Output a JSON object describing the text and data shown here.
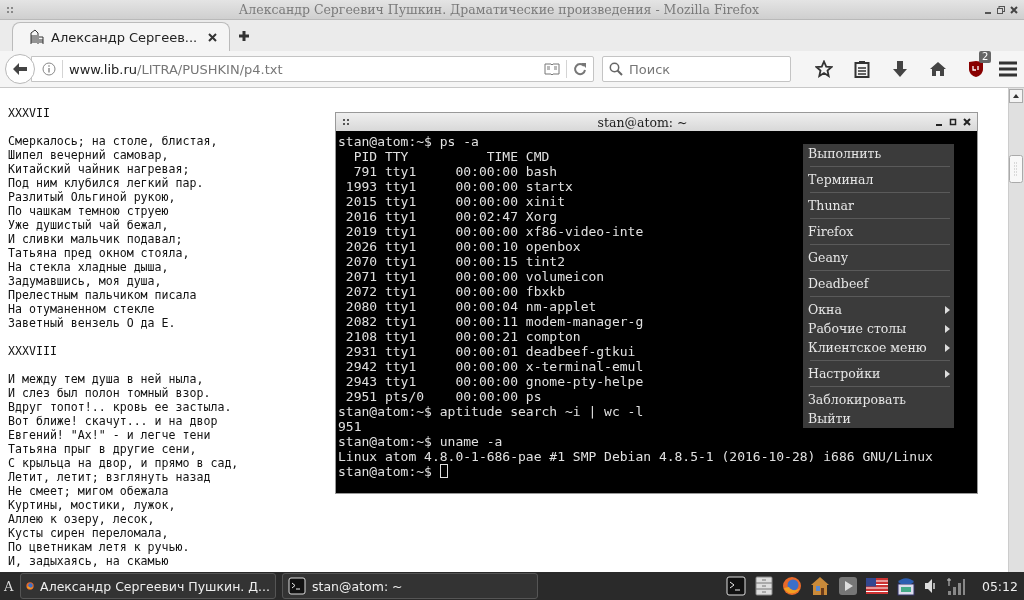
{
  "browser": {
    "title": "Александр Сергеевич Пушкин. Драматические произведения - Mozilla Firefox",
    "tabs": [
      {
        "label": "Александр Сергеев...",
        "selected": true
      }
    ],
    "url": {
      "host": "www.lib.ru",
      "path": "/LITRA/PUSHKIN/p4.txt"
    },
    "search": {
      "placeholder": "Поиск"
    },
    "addon_badge": "2",
    "page": [
      {
        "kind": "heading",
        "text": "XXXVII"
      },
      {
        "kind": "verse",
        "lines": [
          "Смеркалось; на столе, блистая,",
          "Шипел вечерний самовар,",
          "Китайский чайник нагревая;",
          "Под ним клубился легкий пар.",
          "Разлитый Ольгиной рукою,",
          "По чашкам темною струею",
          "Уже душистый чай бежал,",
          "И сливки мальчик подавал;",
          "Татьяна пред окном стояла,",
          "На стекла хладные дыша,",
          "Задумавшись, моя душа,",
          "Прелестным пальчиком писала",
          "На отуманенном стекле",
          "Заветный вензель О да Е."
        ]
      },
      {
        "kind": "heading",
        "text": "XXXVIII"
      },
      {
        "kind": "verse",
        "lines": [
          "И между тем душа в ней ныла,",
          "И слез был полон томный взор.",
          "Вдруг топот!.. кровь ее застыла.",
          "Вот ближе! скачут... и на двор",
          "Евгений! \"Ах!\" - и легче тени",
          "Татьяна прыг в другие сени,",
          "С крыльца на двор, и прямо в сад,",
          "Летит, летит; взглянуть назад",
          "Не смеет; мигом обежала",
          "Куртины, мостики, лужок,",
          "Аллею к озеру, лесок,",
          "Кусты сирен переломала,",
          "По цветникам летя к ручью.",
          "И, задыхаясь, на скамью"
        ]
      }
    ]
  },
  "terminal": {
    "title": "stan@atom: ~",
    "lines": [
      "stan@atom:~$ ps -a",
      "  PID TTY          TIME CMD",
      "  791 tty1     00:00:00 bash",
      " 1993 tty1     00:00:00 startx",
      " 2015 tty1     00:00:00 xinit",
      " 2016 tty1     00:02:47 Xorg",
      " 2019 tty1     00:00:00 xf86-video-inte",
      " 2026 tty1     00:00:10 openbox",
      " 2070 tty1     00:00:15 tint2",
      " 2071 tty1     00:00:00 volumeicon",
      " 2072 tty1     00:00:00 fbxkb",
      " 2080 tty1     00:00:04 nm-applet",
      " 2082 tty1     00:00:11 modem-manager-g",
      " 2108 tty1     00:00:21 compton",
      " 2931 tty1     00:00:01 deadbeef-gtkui",
      " 2942 tty1     00:00:00 x-terminal-emul",
      " 2943 tty1     00:00:00 gnome-pty-helpe",
      " 2951 pts/0    00:00:00 ps",
      "stan@atom:~$ aptitude search ~i | wc -l",
      "951",
      "stan@atom:~$ uname -a",
      "Linux atom 4.8.0-1-686-pae #1 SMP Debian 4.8.5-1 (2016-10-28) i686 GNU/Linux"
    ],
    "prompt": "stan@atom:~$ "
  },
  "menu": {
    "groups": [
      [
        {
          "label": "Выполнить",
          "submenu": false
        }
      ],
      [
        {
          "label": "Терминал",
          "submenu": false
        }
      ],
      [
        {
          "label": "Thunar",
          "submenu": false
        }
      ],
      [
        {
          "label": "Firefox",
          "submenu": false
        }
      ],
      [
        {
          "label": "Geany",
          "submenu": false
        }
      ],
      [
        {
          "label": "Deadbeef",
          "submenu": false
        }
      ],
      [
        {
          "label": "Окна",
          "submenu": true
        },
        {
          "label": "Рабочие столы",
          "submenu": true
        },
        {
          "label": "Клиентское меню",
          "submenu": true
        }
      ],
      [
        {
          "label": "Настройки",
          "submenu": true
        }
      ],
      [
        {
          "label": "Заблокировать",
          "submenu": false
        },
        {
          "label": "Выйти",
          "submenu": false
        }
      ]
    ]
  },
  "taskbar": {
    "desktop": "A",
    "tasks": [
      {
        "kind": "browser",
        "label": "Александр Сергеевич Пушкин. Д..."
      },
      {
        "kind": "terminal",
        "label": "stan@atom: ~"
      }
    ],
    "clock": "05:12"
  }
}
